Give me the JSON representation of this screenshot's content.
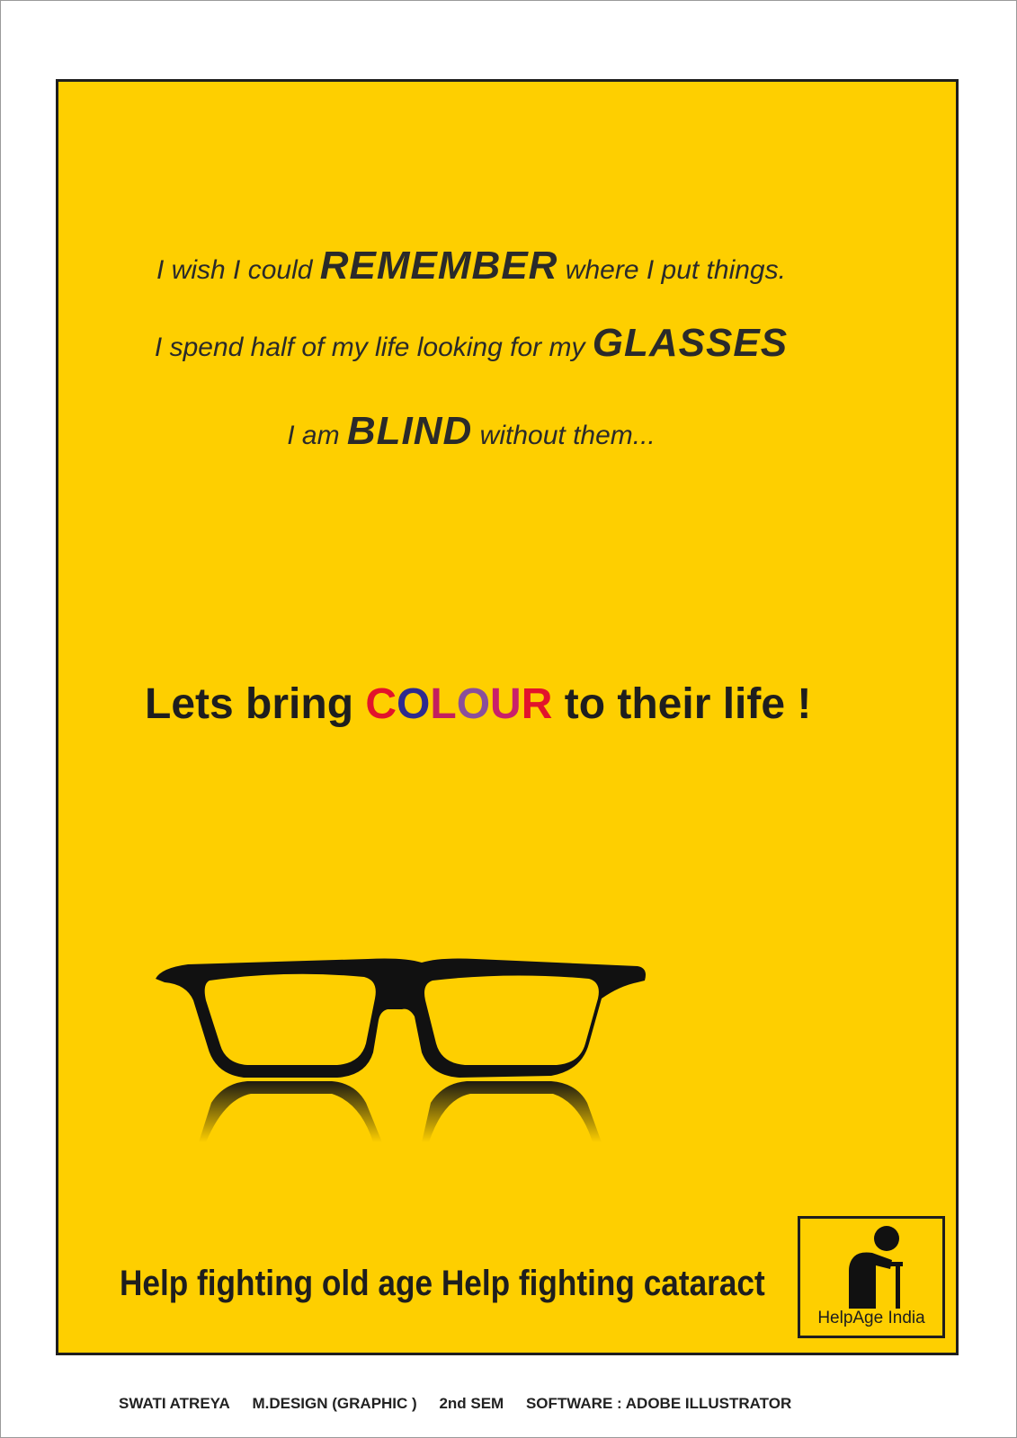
{
  "poster": {
    "background_color": "#fecf00",
    "line1": {
      "pre": "I wish I could ",
      "strong": "REMEMBER",
      "post": " where I put things."
    },
    "line2": {
      "pre": "I spend half of my life looking for my ",
      "strong": "GLASSES",
      "post": ""
    },
    "line3": {
      "pre": "I am ",
      "strong": "BLIND",
      "post": " without them..."
    },
    "slogan": {
      "pre": "Lets bring ",
      "colour_letters": [
        "C",
        "O",
        "L",
        "O",
        "U",
        "R"
      ],
      "colour_colors": [
        "#e2132c",
        "#2e2a8f",
        "#c31f5f",
        "#8a4f9b",
        "#c9206a",
        "#e2132c"
      ],
      "post": " to their life !"
    },
    "glasses_icon": "eyeglasses-with-reflection",
    "tagline": "Help fighting old age Help fighting cataract",
    "logo": {
      "icon": "elderly-person-with-cane-icon",
      "text": "HelpAge India"
    }
  },
  "footer": {
    "name": "SWATI ATREYA",
    "course": "M.DESIGN (GRAPHIC )",
    "semester": "2nd SEM",
    "software": "SOFTWARE : ADOBE ILLUSTRATOR"
  }
}
